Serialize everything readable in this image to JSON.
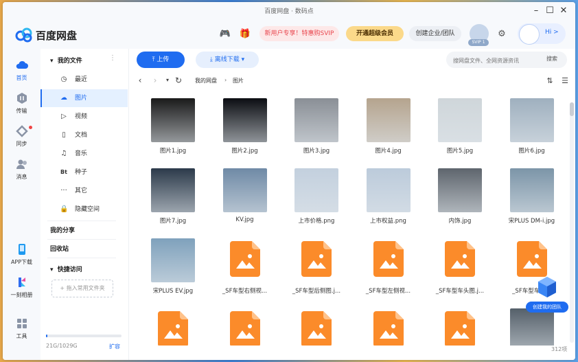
{
  "window": {
    "title": "百度网盘 · 数码点"
  },
  "header": {
    "app_name": "百度网盘",
    "promo_label": "新用户专享！特惠购SVIP",
    "vip_label": "开通超级会员",
    "team_label": "创建企业/团队",
    "avatar_badge": "SVIP 1",
    "mascot_label": "Hi >"
  },
  "nav": {
    "items": [
      {
        "label": "首页"
      },
      {
        "label": "传输"
      },
      {
        "label": "同步"
      },
      {
        "label": "消息"
      },
      {
        "label": "APP下载"
      },
      {
        "label": "一刻相册"
      },
      {
        "label": "工具"
      }
    ]
  },
  "folders": {
    "my_files": "我的文件",
    "items": [
      {
        "label": "最近",
        "icon": "clock-icon"
      },
      {
        "label": "图片",
        "icon": "cloud-image-icon"
      },
      {
        "label": "视频",
        "icon": "play-icon"
      },
      {
        "label": "文档",
        "icon": "document-icon"
      },
      {
        "label": "音乐",
        "icon": "headphones-icon"
      },
      {
        "label": "种子",
        "icon": "bt-icon"
      },
      {
        "label": "其它",
        "icon": "more-icon"
      },
      {
        "label": "隐藏空间",
        "icon": "lock-icon"
      }
    ],
    "my_share": "我的分享",
    "recycle": "回收站",
    "quick_access": "快捷访问",
    "drop_hint": "+ 拖入常用文件夹",
    "storage_text": "21G/1029G",
    "storage_fraction": 0.02,
    "expand_label": "扩容"
  },
  "toolbar": {
    "upload_label": "上传",
    "offline_label": "离线下载",
    "search_placeholder": "搜网盘文件、全网资源资讯",
    "search_button": "搜索"
  },
  "breadcrumb": {
    "root": "我的网盘",
    "current": "图片"
  },
  "files": [
    {
      "name": "图片1.jpg",
      "type": "photo",
      "color": "#1a1a1a"
    },
    {
      "name": "图片2.jpg",
      "type": "photo",
      "color": "#0b0d12"
    },
    {
      "name": "图片3.jpg",
      "type": "photo",
      "color": "#8a8f96"
    },
    {
      "name": "图片4.jpg",
      "type": "photo",
      "color": "#b5a48e"
    },
    {
      "name": "图片5.jpg",
      "type": "photo",
      "color": "#cfd6da"
    },
    {
      "name": "图片6.jpg",
      "type": "photo",
      "color": "#9fb0bf"
    },
    {
      "name": "图片7.jpg",
      "type": "photo",
      "color": "#2c3a4a"
    },
    {
      "name": "KV.jpg",
      "type": "photo",
      "color": "#6f8aa6"
    },
    {
      "name": "上市价格.png",
      "type": "photo",
      "color": "#c3d0de"
    },
    {
      "name": "上市权益.png",
      "type": "photo",
      "color": "#bccbdb"
    },
    {
      "name": "内饰.jpg",
      "type": "photo",
      "color": "#5e656d"
    },
    {
      "name": "宋PLUS DM-i.jpg",
      "type": "photo",
      "color": "#7c95a8"
    },
    {
      "name": "宋PLUS EV.jpg",
      "type": "photo",
      "color": "#7fa1bc"
    },
    {
      "name": "_SF车型右侧视...",
      "type": "image-file"
    },
    {
      "name": "_SF车型后侧图.j...",
      "type": "image-file"
    },
    {
      "name": "_SF车型左侧视...",
      "type": "image-file"
    },
    {
      "name": "_SF车型车头图.j...",
      "type": "image-file"
    },
    {
      "name": "_SF车型车头...",
      "type": "image-file"
    },
    {
      "name": "",
      "type": "image-file"
    },
    {
      "name": "",
      "type": "image-file"
    },
    {
      "name": "",
      "type": "image-file"
    },
    {
      "name": "",
      "type": "image-file"
    },
    {
      "name": "",
      "type": "image-file"
    },
    {
      "name": "",
      "type": "photo",
      "color": "#55606a"
    }
  ],
  "team_float_label": "创建我的团队",
  "total_count": "312项",
  "colors": {
    "accent": "#1f6cf0",
    "file_icon": "#fb8b2a"
  }
}
